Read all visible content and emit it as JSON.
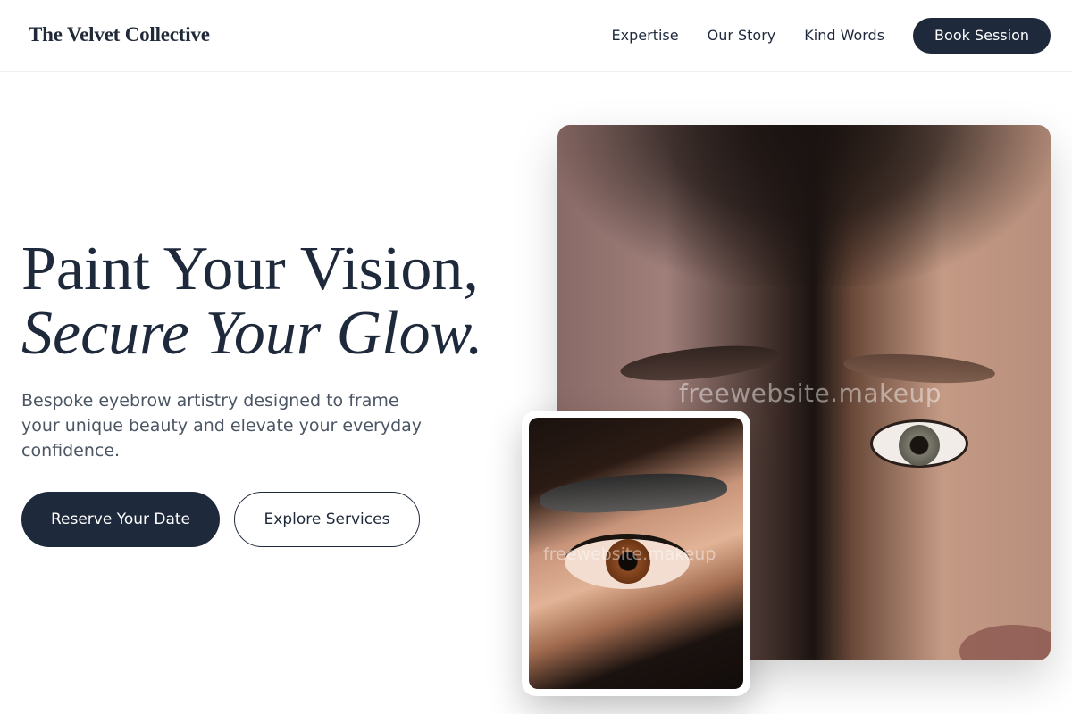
{
  "nav": {
    "brand": "The Velvet Collective",
    "links": [
      "Expertise",
      "Our Story",
      "Kind Words"
    ],
    "cta": "Book Session"
  },
  "hero": {
    "headline_line1": "Paint Your Vision,",
    "headline_line2": "Secure Your Glow.",
    "lead": "Bespoke eyebrow artistry designed to frame your unique beauty and elevate your everyday confidence.",
    "primary_cta": "Reserve Your Date",
    "secondary_cta": "Explore Services"
  },
  "images": {
    "main_watermark": "freewebsite.makeup",
    "inset_watermark": "freewebsite.makeup"
  },
  "colors": {
    "accent": "#1e293b",
    "text_muted": "#4b5563",
    "background": "#ffffff"
  }
}
